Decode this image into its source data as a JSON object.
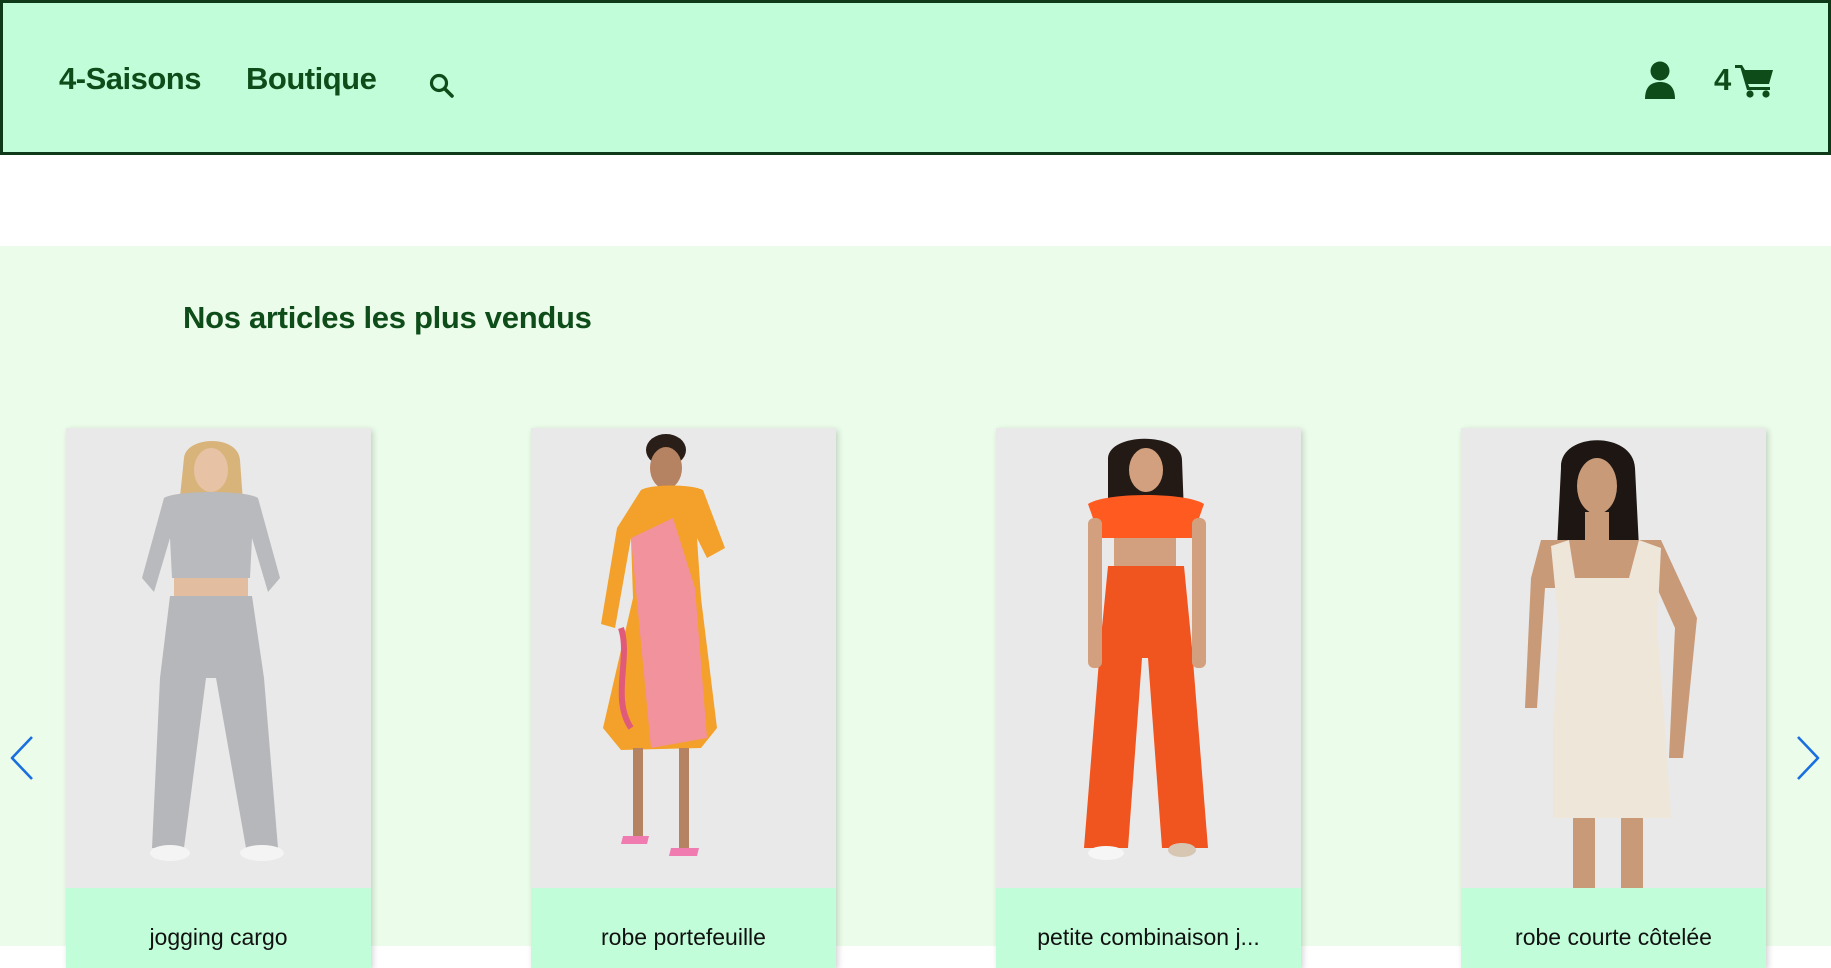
{
  "header": {
    "brand": "4-Saisons",
    "nav_shop": "Boutique",
    "cart_count": "4",
    "icons": {
      "search": "search-icon",
      "account": "user-icon",
      "cart": "cart-icon"
    }
  },
  "colors": {
    "header_bg": "#c1fdd8",
    "header_border": "#0f3a1a",
    "text_dark_green": "#0e4d1a",
    "section_bg": "#ebfdea",
    "arrow_blue": "#1a6fe0"
  },
  "bestsellers": {
    "title": "Nos articles les plus vendus",
    "prev_icon": "chevron-left-icon",
    "next_icon": "chevron-right-icon",
    "products": [
      {
        "name": "jogging cargo"
      },
      {
        "name": "robe portefeuille"
      },
      {
        "name": "petite combinaison j..."
      },
      {
        "name": "robe courte côtelée"
      }
    ]
  }
}
